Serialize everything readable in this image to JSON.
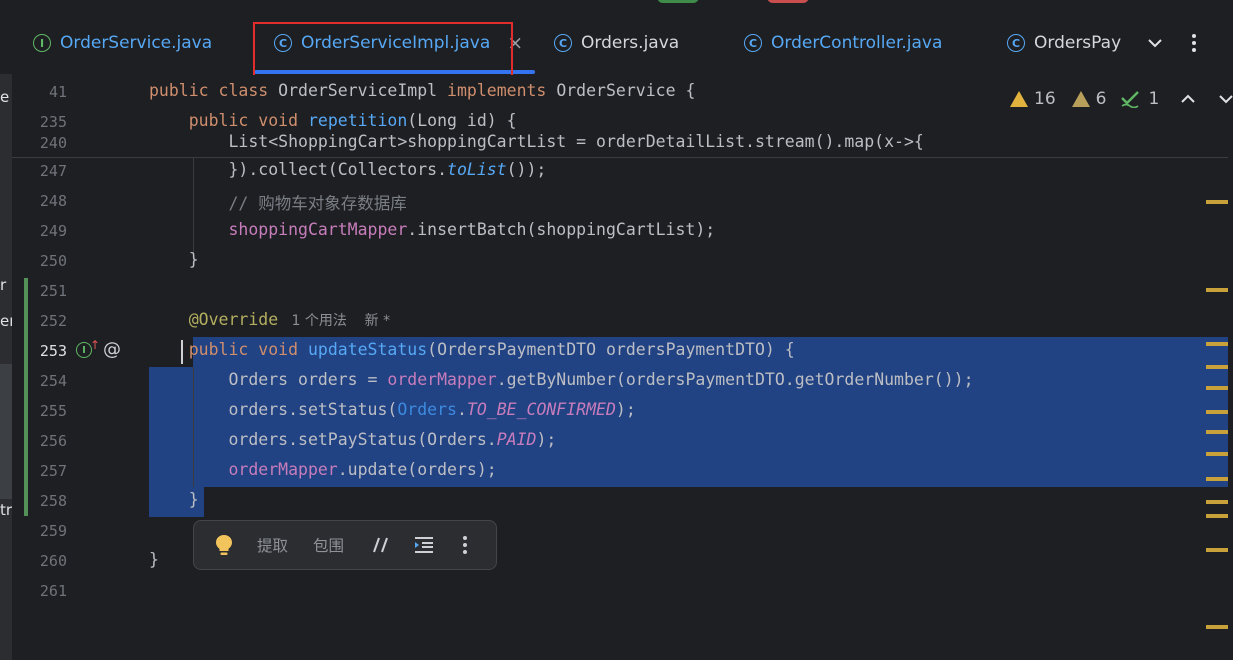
{
  "tabs": [
    {
      "label": "OrderService.java",
      "icon": "interface-icon",
      "glyph": "I",
      "color": "#5fb865",
      "labelColor": "#56a8f5"
    },
    {
      "label": "OrderServiceImpl.java",
      "icon": "class-icon",
      "glyph": "C",
      "color": "#56a8f5",
      "labelColor": "#56a8f5",
      "active": true
    },
    {
      "label": "Orders.java",
      "icon": "class-icon",
      "glyph": "C",
      "color": "#56a8f5",
      "labelColor": "#d4d6db"
    },
    {
      "label": "OrderController.java",
      "icon": "class-icon",
      "glyph": "C",
      "color": "#56a8f5",
      "labelColor": "#56a8f5"
    },
    {
      "label": "OrdersPay",
      "icon": "class-icon",
      "glyph": "C",
      "color": "#56a8f5",
      "labelColor": "#d4d6db"
    }
  ],
  "tab_close": "×",
  "left_edge": [
    "e",
    "r",
    "er",
    "tr"
  ],
  "inspection": {
    "warnings": "16",
    "weak_warnings": "6",
    "typos": "1"
  },
  "sticky": [
    {
      "line": "41",
      "parts": [
        [
          "kw",
          "public class "
        ],
        [
          "txt",
          "OrderServiceImpl "
        ],
        [
          "kw",
          "implements "
        ],
        [
          "txt",
          "OrderService {"
        ]
      ]
    },
    {
      "line": "235",
      "parts": [
        [
          "kw",
          "    public void "
        ],
        [
          "fn",
          "repetition"
        ],
        [
          "txt",
          "(Long id) {"
        ]
      ]
    },
    {
      "line": "240",
      "parts": [
        [
          "txt",
          "        List<ShoppingCart>shoppingCartList = orderDetailList.stream().map(x->{"
        ]
      ]
    }
  ],
  "lines": [
    {
      "line": "247",
      "parts": [
        [
          "txt",
          "        }).collect(Collectors."
        ],
        [
          "fn ital",
          "toList"
        ],
        [
          "txt",
          "());"
        ]
      ]
    },
    {
      "line": "248",
      "parts": [
        [
          "cmt",
          "        // 购物车对象存数据库"
        ]
      ]
    },
    {
      "line": "249",
      "parts": [
        [
          "fld",
          "        shoppingCartMapper"
        ],
        [
          "txt",
          ".insertBatch(shoppingCartList);"
        ]
      ]
    },
    {
      "line": "250",
      "parts": [
        [
          "txt",
          "    }"
        ]
      ]
    },
    {
      "line": "251",
      "parts": []
    },
    {
      "line": "252",
      "parts": [
        [
          "ann",
          "    @Override"
        ],
        [
          "hint",
          "   1 个用法    新 *"
        ]
      ]
    },
    {
      "line": "253",
      "parts": [
        [
          "kw",
          "    public void "
        ],
        [
          "fn",
          "updateStatus"
        ],
        [
          "txt",
          "(OrdersPaymentDTO ordersPaymentDTO) {"
        ]
      ]
    },
    {
      "line": "254",
      "parts": [
        [
          "txt",
          "        Orders orders = "
        ],
        [
          "fld",
          "orderMapper"
        ],
        [
          "txt",
          ".getByNumber(ordersPaymentDTO.getOrderNumber());"
        ]
      ]
    },
    {
      "line": "255",
      "parts": [
        [
          "txt",
          "        orders.setStatus("
        ],
        [
          "cls",
          "Orders"
        ],
        [
          "txt",
          "."
        ],
        [
          "fld ital",
          "TO_BE_CONFIRMED"
        ],
        [
          "txt",
          ");"
        ]
      ]
    },
    {
      "line": "256",
      "parts": [
        [
          "txt",
          "        orders.setPayStatus(Orders."
        ],
        [
          "fld ital",
          "PAID"
        ],
        [
          "txt",
          ");"
        ]
      ]
    },
    {
      "line": "257",
      "parts": [
        [
          "fld",
          "        orderMapper"
        ],
        [
          "txt",
          ".update(orders);"
        ]
      ]
    },
    {
      "line": "258",
      "parts": [
        [
          "txt",
          "    }"
        ]
      ]
    },
    {
      "line": "259",
      "parts": []
    },
    {
      "line": "260",
      "parts": [
        [
          "txt",
          "}"
        ]
      ]
    },
    {
      "line": "261",
      "parts": []
    }
  ],
  "popup": {
    "extract": "提取",
    "surround": "包围"
  }
}
